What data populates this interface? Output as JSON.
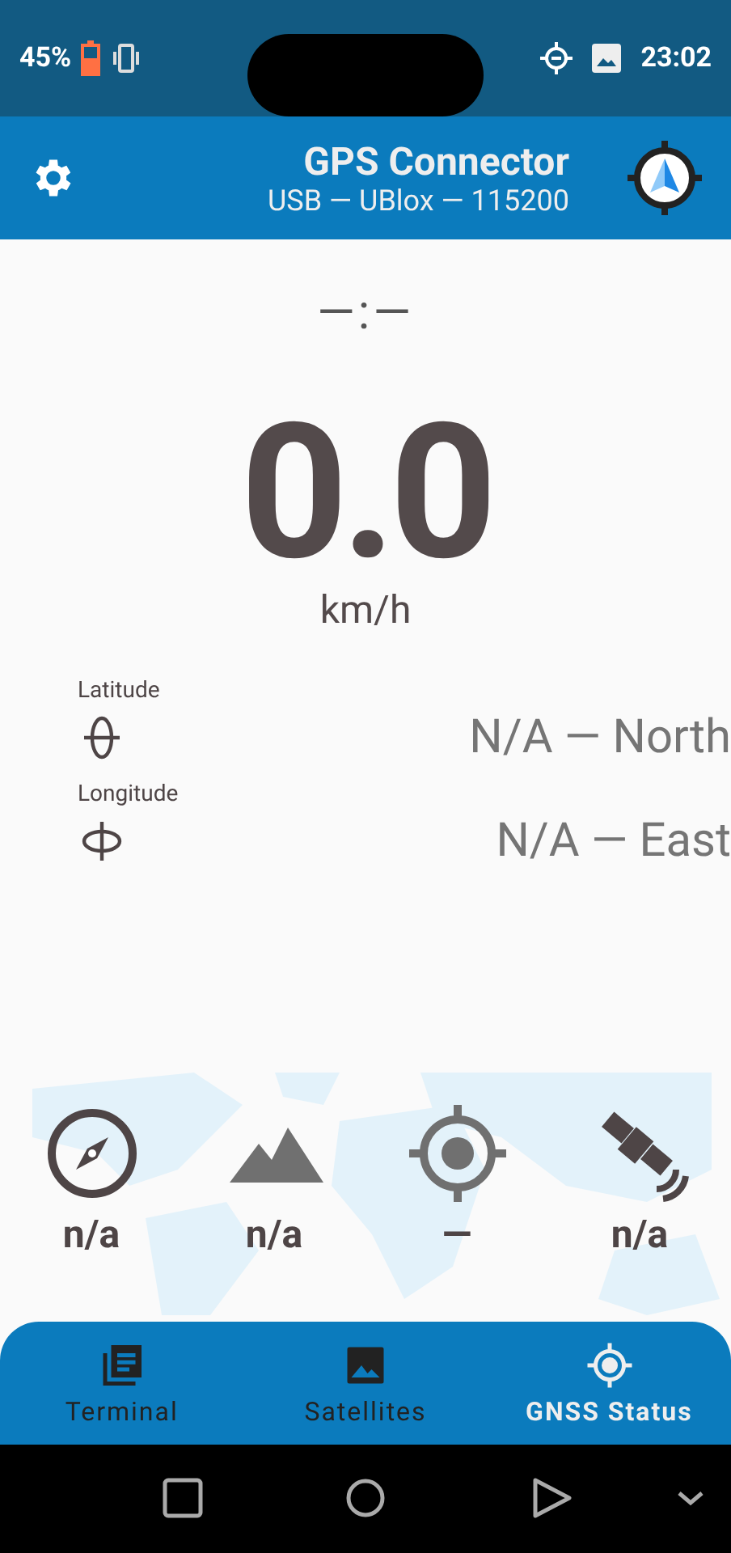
{
  "status_bar": {
    "battery": "45%",
    "time": "23:02"
  },
  "app_bar": {
    "title": "GPS Connector",
    "subtitle": "USB — UBlox — 115200"
  },
  "time": "—:—",
  "speed": {
    "value": "0.0",
    "unit": "km/h"
  },
  "coordinates": [
    {
      "label": "Latitude",
      "kind": "latitude",
      "value": "N/A — North"
    },
    {
      "label": "Longitude",
      "kind": "longitude",
      "value": "N/A — East"
    }
  ],
  "stats": [
    {
      "kind": "bearing",
      "value": "n/a"
    },
    {
      "kind": "altitude",
      "value": "n/a"
    },
    {
      "kind": "accuracy",
      "value": "—"
    },
    {
      "kind": "satellites",
      "value": "n/a"
    }
  ],
  "tabs": [
    {
      "label": "Terminal",
      "kind": "terminal",
      "selected": false
    },
    {
      "label": "Satellites",
      "kind": "satellites",
      "selected": false
    },
    {
      "label": "GNSS Status",
      "kind": "gnss",
      "selected": true
    }
  ]
}
